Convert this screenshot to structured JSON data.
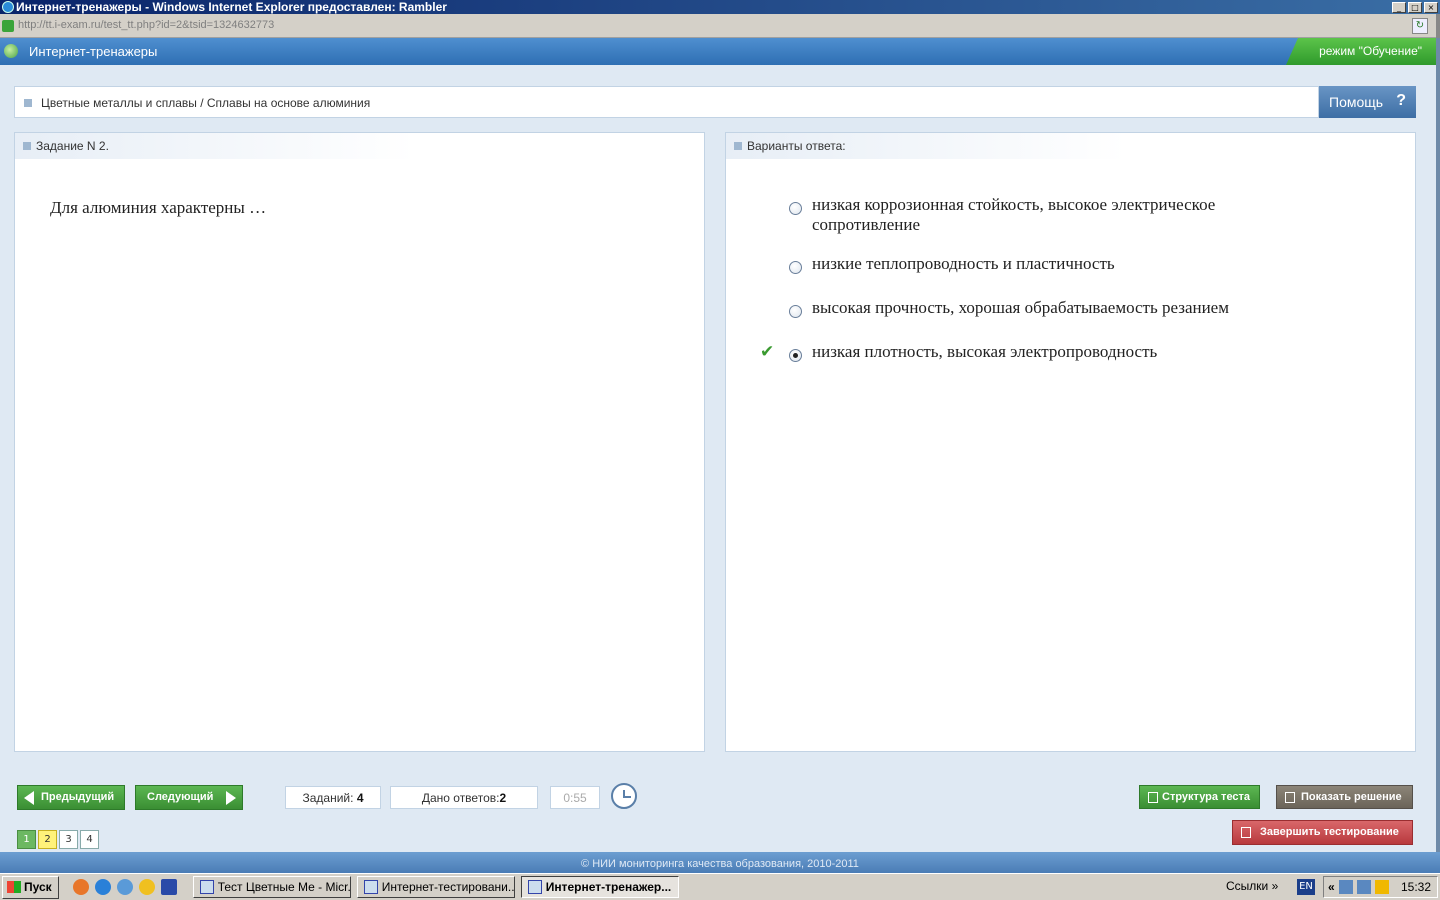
{
  "browser": {
    "title": "Интернет-тренажеры - Windows Internet Explorer предоставлен: Rambler",
    "url": "http://tt.i-exam.ru/test_tt.php?id=2&tsid=1324632773"
  },
  "app": {
    "title": "Интернет-тренажеры",
    "mode": "режим \"Обучение\""
  },
  "breadcrumb": "Цветные металлы и сплавы / Сплавы на основе алюминия",
  "help_label": "Помощь",
  "task": {
    "title": "Задание N 2.",
    "question": "Для алюминия характерны …"
  },
  "answers": {
    "title": "Варианты ответа:",
    "options": [
      {
        "text": "низкая коррозионная стойкость, высокое электрическое сопротивление",
        "selected": false,
        "correct": false
      },
      {
        "text": "низкие теплопроводность и пластичность",
        "selected": false,
        "correct": false
      },
      {
        "text": "высокая прочность, хорошая обрабатываемость резанием",
        "selected": false,
        "correct": false
      },
      {
        "text": "низкая плотность, высокая электропроводность",
        "selected": true,
        "correct": true
      }
    ]
  },
  "nav": {
    "prev": "Предыдущий",
    "next": "Следующий",
    "tasks_label": "Заданий:",
    "tasks_count": "4",
    "answers_label": "Дано ответов:",
    "answers_count": "2",
    "timer": "0:55",
    "pages": [
      "1",
      "2",
      "3",
      "4"
    ],
    "structure": "Структура теста",
    "show_solution": "Показать решение",
    "finish": "Завершить тестирование"
  },
  "footer": "© НИИ мониторинга качества образования, 2010-2011",
  "taskbar": {
    "start": "Пуск",
    "tasks": [
      "Тест Цветные Ме - Micr...",
      "Интернет-тестировани...",
      "Интернет-тренажер..."
    ],
    "links": "Ссылки",
    "lang": "EN",
    "clock": "15:32"
  },
  "colors": {
    "accent_green": "#3a8e33",
    "header_blue": "#2e6fb3",
    "finish_red": "#b8393d"
  }
}
